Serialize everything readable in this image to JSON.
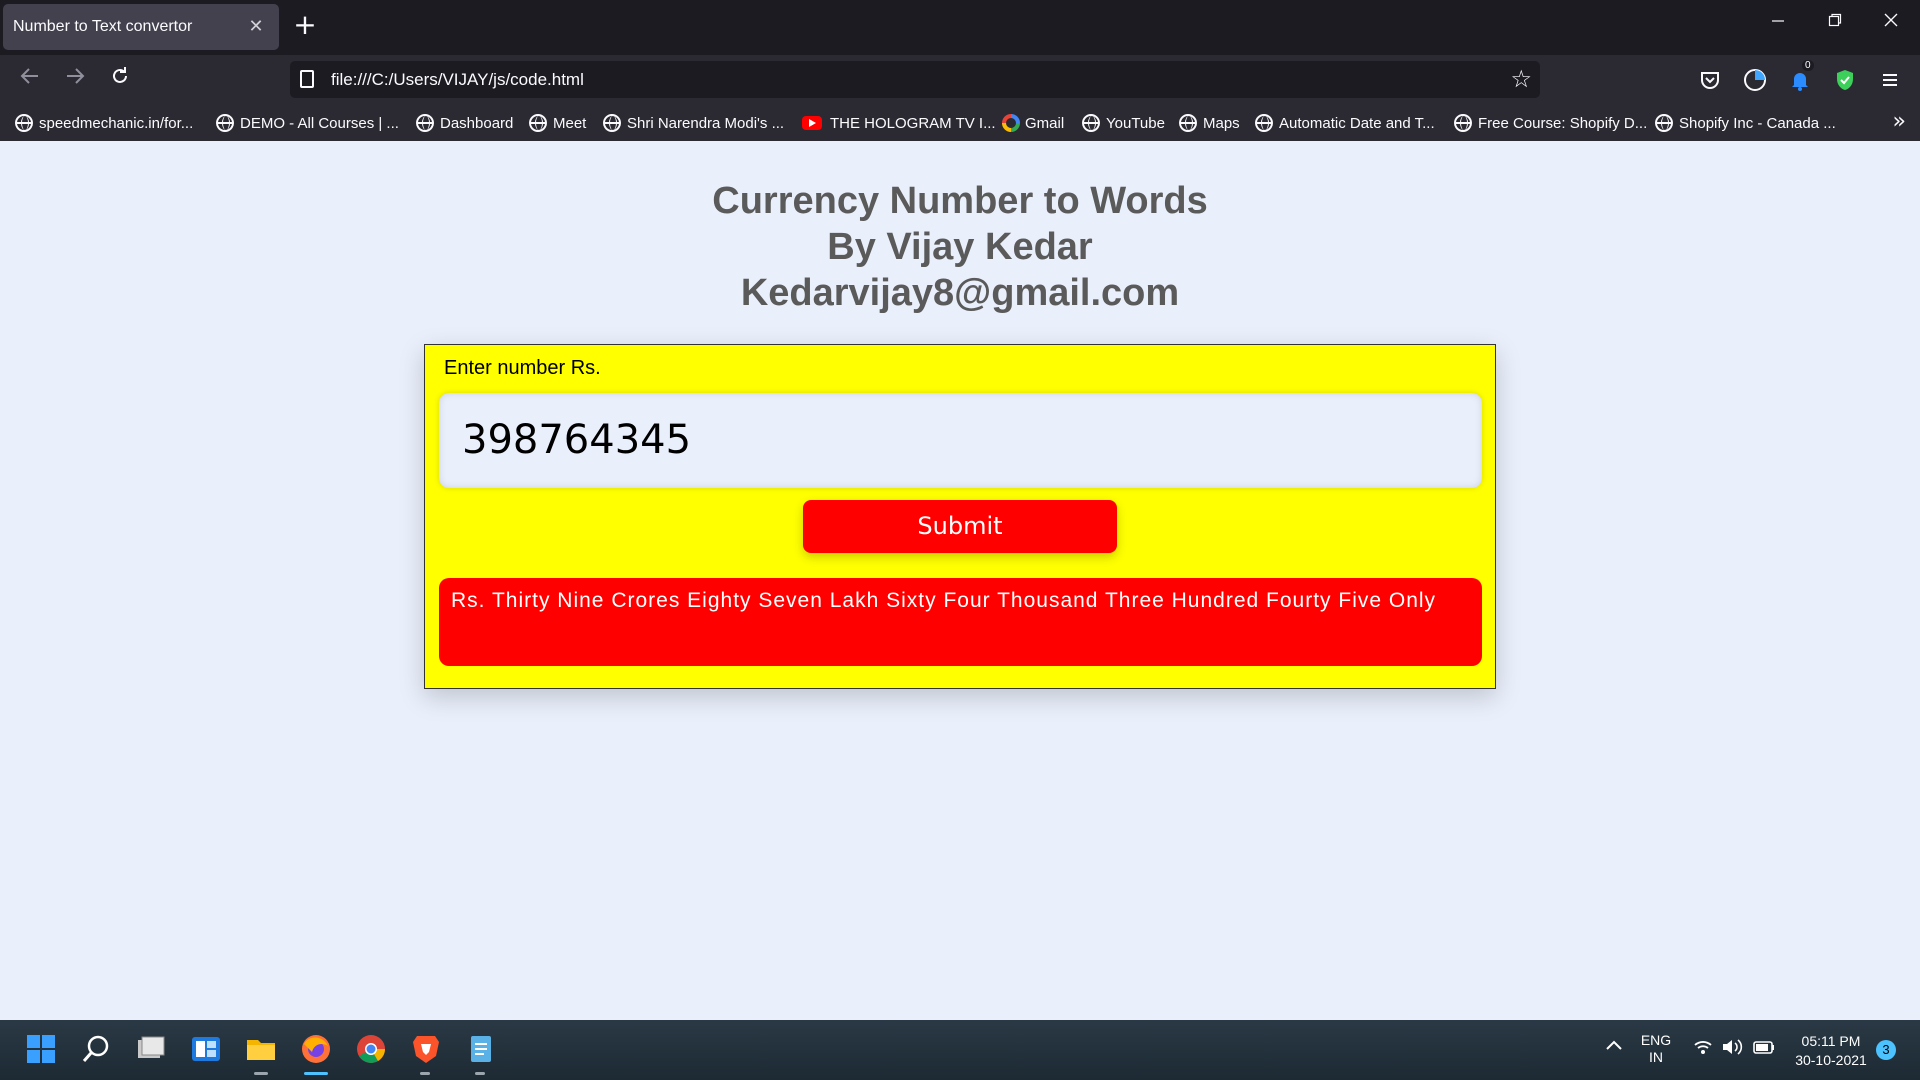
{
  "browser": {
    "tab_title": "Number to Text convertor",
    "tab_close": "✕",
    "new_tab": "+",
    "url": "file:///C:/Users/VIJAY/js/code.html",
    "toolbar_badge": "0",
    "bookmarks": [
      {
        "label": "speedmechanic.in/for...",
        "icon": "globe-icon"
      },
      {
        "label": "DEMO - All Courses | ...",
        "icon": "globe-icon"
      },
      {
        "label": "Dashboard",
        "icon": "globe-icon"
      },
      {
        "label": "Meet",
        "icon": "globe-icon"
      },
      {
        "label": "Shri Narendra Modi's ...",
        "icon": "globe-icon"
      },
      {
        "label": "THE HOLOGRAM TV I...",
        "icon": "youtube-icon"
      },
      {
        "label": "Gmail",
        "icon": "google-icon"
      },
      {
        "label": "YouTube",
        "icon": "globe-icon"
      },
      {
        "label": "Maps",
        "icon": "globe-icon"
      },
      {
        "label": "Automatic Date and T...",
        "icon": "globe-icon"
      },
      {
        "label": "Free Course: Shopify D...",
        "icon": "globe-icon"
      },
      {
        "label": "Shopify Inc - Canada ...",
        "icon": "globe-icon"
      }
    ]
  },
  "page": {
    "heading_line1": "Currency Number to Words",
    "heading_line2": "By Vijay Kedar",
    "heading_line3": "Kedarvijay8@gmail.com",
    "input_label": "Enter number Rs.",
    "input_value": "398764345",
    "submit_label": "Submit",
    "result_text": "Rs. Thirty Nine Crores Eighty Seven Lakh Sixty Four Thousand Three Hundred Fourty Five Only"
  },
  "taskbar": {
    "lang_line1": "ENG",
    "lang_line2": "IN",
    "time": "05:11 PM",
    "date": "30-10-2021",
    "notification_count": "3"
  },
  "colors": {
    "page_bg": "#e9effb",
    "card_bg": "#ffff00",
    "accent_red": "#ff0000",
    "heading": "#5a5a5a"
  }
}
